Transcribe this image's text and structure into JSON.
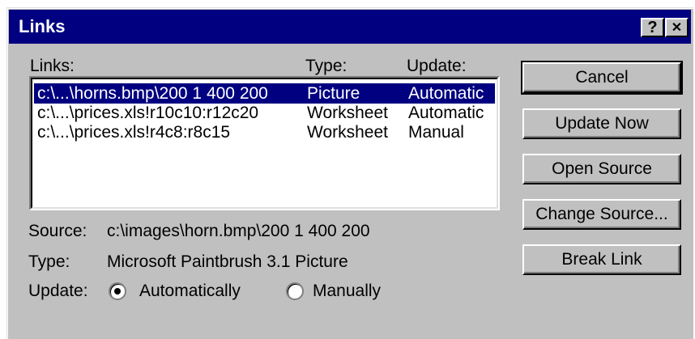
{
  "window": {
    "title": "Links",
    "help_glyph": "?",
    "close_glyph": "✕"
  },
  "list": {
    "col_links": "Links:",
    "col_type": "Type:",
    "col_update": "Update:",
    "rows": [
      {
        "link": "c:\\...\\horns.bmp\\200 1 400 200",
        "type": "Picture",
        "update": "Automatic",
        "selected": true
      },
      {
        "link": "c:\\...\\prices.xls!r10c10:r12c20",
        "type": "Worksheet",
        "update": "Automatic",
        "selected": false
      },
      {
        "link": "c:\\...\\prices.xls!r4c8:r8c15",
        "type": "Worksheet",
        "update": "Manual",
        "selected": false
      }
    ]
  },
  "details": {
    "source_label": "Source:",
    "source_value": "c:\\images\\horn.bmp\\200 1 400 200",
    "type_label": "Type:",
    "type_value": "Microsoft Paintbrush 3.1 Picture",
    "update_label": "Update:",
    "automatic_label": "Automatically",
    "manual_label": "Manually",
    "update_selected": "automatic"
  },
  "buttons": {
    "cancel": "Cancel",
    "update_now": "Update Now",
    "open_source": "Open Source",
    "change_source": "Change Source...",
    "break_link": "Break Link"
  },
  "colors": {
    "titlebar": "#000080",
    "face": "#c0c0c0",
    "selection": "#000080"
  }
}
